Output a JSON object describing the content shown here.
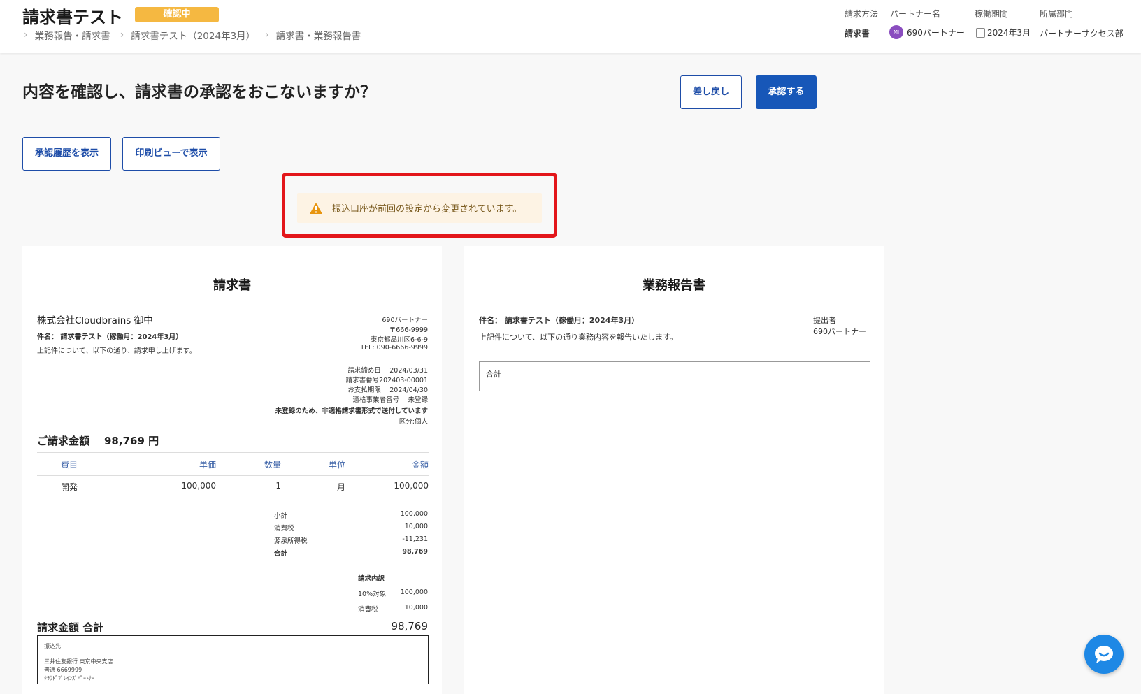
{
  "header": {
    "title": "請求書テスト",
    "status_badge": "確認中",
    "breadcrumb": [
      "業務報告・請求書",
      "請求書テスト（2024年3月）",
      "請求書・業務報告書"
    ],
    "meta": {
      "method_label": "請求方法",
      "method_value": "請求書",
      "partner_label": "パートナー名",
      "partner_avatar": "MI",
      "partner_value": "690パートナー",
      "period_label": "稼働期間",
      "period_value": "2024年3月",
      "dept_label": "所属部門",
      "dept_value": "パートナーサクセス部"
    }
  },
  "question": "内容を確認し、請求書の承認をおこないますか？",
  "buttons": {
    "return": "差し戻し",
    "approve": "承認する",
    "history": "承認履歴を表示",
    "print": "印刷ビューで表示"
  },
  "warning": {
    "icon": "warning-icon",
    "text": "振込口座が前回の設定から変更されています。"
  },
  "invoice": {
    "title": "請求書",
    "recipient": "株式会社Cloudbrains 御中",
    "subject": "件名： 請求書テスト（稼働月：2024年3月）",
    "intro": "上記件について、以下の通り、請求申し上げます。",
    "issuer": {
      "name": "690パートナー",
      "postal": "〒666-9999",
      "address": "東京都品川区6-6-9",
      "tel": "TEL: 090-6666-9999"
    },
    "info": {
      "closing": "請求締め日　 2024/03/31",
      "number": "請求書番号202403-00001",
      "due": "お支払期限　 2024/04/30",
      "qualified": "適格事業者番号　 未登録",
      "notice": "未登録のため、非適格請求書形式で送付しています",
      "category": "区分:個人"
    },
    "amount_label": "ご請求金額",
    "amount_value": "98,769 円",
    "table_headers": [
      "費目",
      "単価",
      "数量",
      "単位",
      "金額"
    ],
    "rows": [
      [
        "開発",
        "100,000",
        "1",
        "月",
        "100,000"
      ]
    ],
    "summary": {
      "subtotal_label": "小計",
      "subtotal": "100,000",
      "tax_label": "消費税",
      "tax": "10,000",
      "withholding_label": "源泉所得税",
      "withholding": "-11,231",
      "total_label": "合計",
      "total": "98,769"
    },
    "breakdown": {
      "title": "請求内訳",
      "target_label": "10%対象",
      "target": "100,000",
      "tax_label": "消費税",
      "tax": "10,000"
    },
    "grand_label": "請求金額 合計",
    "grand_value": "98,769",
    "bank": {
      "label": "振込先",
      "line1": "三井住友銀行 東京中央支店",
      "line2": "普通 6669999",
      "line3": "ｸﾗｳﾄﾞﾌﾞﾚｲﾝｽﾞﾊﾟｰﾄﾅｰ"
    }
  },
  "report": {
    "title": "業務報告書",
    "subject": "件名： 請求書テスト（稼働月：2024年3月）",
    "intro": "上記件について、以下の通り業務内容を報告いたします。",
    "submitter_label": "提出者",
    "submitter": "690パートナー",
    "total_label": "合計"
  },
  "colors": {
    "accent": "#1757b8",
    "badge": "#f5b841",
    "warning_bg": "#fdf3e4",
    "highlight": "#e3161a"
  }
}
